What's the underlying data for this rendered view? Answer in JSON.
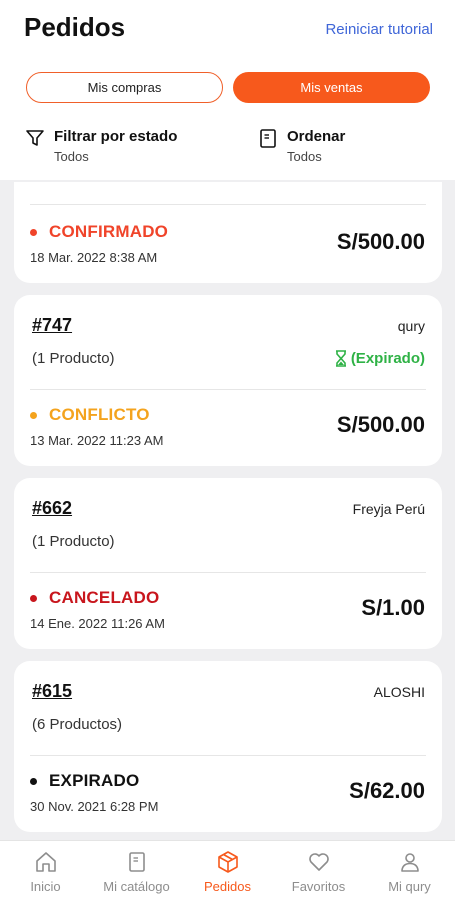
{
  "header": {
    "title": "Pedidos",
    "reset_tutorial": "Reiniciar tutorial"
  },
  "segments": {
    "purchases": "Mis compras",
    "sales": "Mis ventas",
    "active": "sales"
  },
  "filters": {
    "state_title": "Filtrar por estado",
    "state_value": "Todos",
    "order_title": "Ordenar",
    "order_value": "Todos"
  },
  "orders": [
    {
      "status": "CONFIRMADO",
      "status_color": "#f0442a",
      "date": "18 Mar. 2022  8:38 AM",
      "price": "S/500.00"
    },
    {
      "number": "#747",
      "seller": "qury",
      "products": "(1 Producto)",
      "badge": "(Expirado)",
      "status": "CONFLICTO",
      "status_color": "#f4a31d",
      "date": "13 Mar. 2022  11:23 AM",
      "price": "S/500.00"
    },
    {
      "number": "#662",
      "seller": "Freyja Perú",
      "products": "(1 Producto)",
      "status": "CANCELADO",
      "status_color": "#c8161d",
      "date": "14 Ene. 2022  11:26 AM",
      "price": "S/1.00"
    },
    {
      "number": "#615",
      "seller": "ALOSHI",
      "products": "(6 Productos)",
      "status": "EXPIRADO",
      "status_color": "#111111",
      "date": "30 Nov. 2021  6:28 PM",
      "price": "S/62.00"
    }
  ],
  "tabbar": {
    "items": [
      {
        "label": "Inicio",
        "icon": "home-icon"
      },
      {
        "label": "Mi catálogo",
        "icon": "catalog-icon"
      },
      {
        "label": "Pedidos",
        "icon": "box-icon"
      },
      {
        "label": "Favoritos",
        "icon": "heart-icon"
      },
      {
        "label": "Mi qury",
        "icon": "user-icon"
      }
    ],
    "active": "Pedidos"
  },
  "colors": {
    "accent": "#f7591c",
    "link": "#3f66d8",
    "expired_badge": "#2fb246"
  }
}
